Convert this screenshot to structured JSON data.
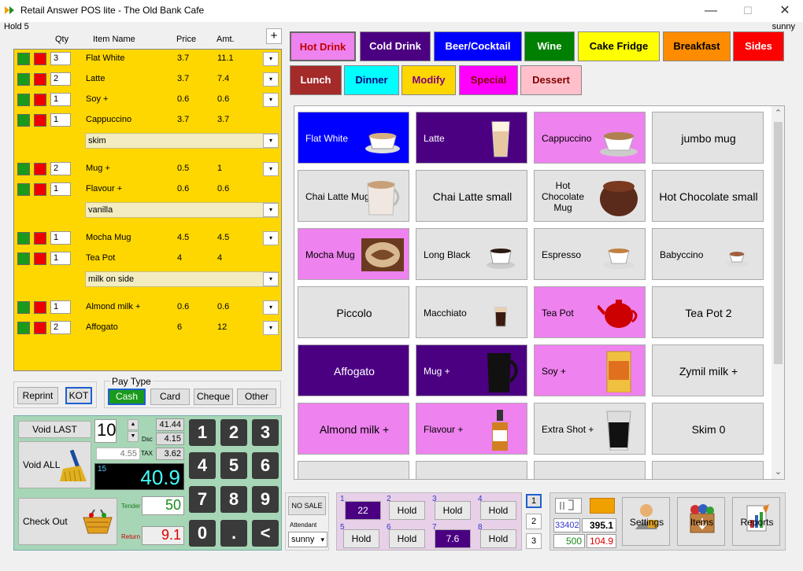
{
  "window": {
    "title": "Retail Answer POS lite - The Old Bank Cafe",
    "minimize": "—",
    "maximize": "☐",
    "close": "✕"
  },
  "hold_label": "Hold 5",
  "user": "sunny",
  "order_headers": {
    "add": "+",
    "qty": "Qty",
    "name": "Item Name",
    "price": "Price",
    "amt": "Amt."
  },
  "order_rows": [
    {
      "qty": "3",
      "name": "Flat White",
      "price": "3.7",
      "amt": "11.1"
    },
    {
      "qty": "2",
      "name": "Latte",
      "price": "3.7",
      "amt": "7.4"
    },
    {
      "qty": "1",
      "name": "Soy +",
      "price": "0.6",
      "amt": "0.6"
    },
    {
      "qty": "1",
      "name": "Cappuccino",
      "price": "3.7",
      "amt": "3.7"
    },
    {
      "qty": "2",
      "name": "Mug +",
      "price": "0.5",
      "amt": "1"
    },
    {
      "qty": "1",
      "name": "Flavour +",
      "price": "0.6",
      "amt": "0.6"
    },
    {
      "qty": "1",
      "name": "Mocha Mug",
      "price": "4.5",
      "amt": "4.5"
    },
    {
      "qty": "1",
      "name": "Tea Pot",
      "price": "4",
      "amt": "4"
    },
    {
      "qty": "1",
      "name": "Almond milk +",
      "price": "0.6",
      "amt": "0.6"
    },
    {
      "qty": "2",
      "name": "Affogato",
      "price": "6",
      "amt": "12"
    }
  ],
  "modifiers": [
    "skim",
    "vanilla",
    "milk on side"
  ],
  "dropdown_arrow": "▾",
  "reprint": "Reprint",
  "kot": "KOT",
  "pay_type": {
    "label": "Pay Type",
    "cash": "Cash",
    "card": "Card",
    "cheque": "Cheque",
    "other": "Other"
  },
  "actions": {
    "void_last": "Void LAST",
    "void_all": "Void ALL",
    "check_out": "Check Out"
  },
  "qty_entry": "10",
  "spin_up": "▲",
  "spin_down": "▼",
  "totals": {
    "subtotal": "41.44",
    "dsc_label": "Dsc",
    "dsc": "4.15",
    "tax_label": "TAX",
    "tax": "3.62",
    "net": "4.55",
    "count": "15",
    "total": "40.9",
    "tender_label": "Tender",
    "tender": "50",
    "return_label": "Return",
    "return": "9.1"
  },
  "keypad": [
    "1",
    "2",
    "3",
    "4",
    "5",
    "6",
    "7",
    "8",
    "9",
    "0",
    ".",
    "<"
  ],
  "categories": [
    {
      "label": "Hot Drink",
      "bg": "#ee82ee",
      "fg": "#c00000"
    },
    {
      "label": "Cold Drink",
      "bg": "#4b0082",
      "fg": "#ffffff"
    },
    {
      "label": "Beer/Cocktail",
      "bg": "#0000ff",
      "fg": "#ffffff"
    },
    {
      "label": "Wine",
      "bg": "#008000",
      "fg": "#ffffff"
    },
    {
      "label": "Cake Fridge",
      "bg": "#ffff00",
      "fg": "#000000"
    },
    {
      "label": "Breakfast",
      "bg": "#ff8c00",
      "fg": "#000000"
    },
    {
      "label": "Sides",
      "bg": "#ff0000",
      "fg": "#ffffff"
    },
    {
      "label": "Lunch",
      "bg": "#a52a2a",
      "fg": "#ffffff"
    },
    {
      "label": "Dinner",
      "bg": "#00ffff",
      "fg": "#000080"
    },
    {
      "label": "Modify",
      "bg": "#ffd700",
      "fg": "#800080"
    },
    {
      "label": "Special",
      "bg": "#ff00ff",
      "fg": "#800000"
    },
    {
      "label": "Dessert",
      "bg": "#ffc0cb",
      "fg": "#800000"
    }
  ],
  "menu_items": [
    {
      "label": "Flat White",
      "bg": "#0000ff",
      "fg": "#ffffff",
      "icon": "flat-white-cup-icon"
    },
    {
      "label": "Latte",
      "bg": "#4b0082",
      "fg": "#ffffff",
      "icon": "latte-glass-icon"
    },
    {
      "label": "Cappuccino",
      "bg": "#ee82ee",
      "fg": "#000000",
      "icon": "cappuccino-cup-icon"
    },
    {
      "label": "jumbo mug",
      "bg": "#e3e3e3",
      "fg": "#000000",
      "icon": ""
    },
    {
      "label": "Chai Latte Mug",
      "bg": "#e3e3e3",
      "fg": "#000000",
      "icon": "chai-latte-mug-icon"
    },
    {
      "label": "Chai Latte small",
      "bg": "#e3e3e3",
      "fg": "#000000",
      "icon": ""
    },
    {
      "label": "Hot Chocolate Mug",
      "bg": "#e3e3e3",
      "fg": "#000000",
      "icon": "hot-chocolate-mug-icon"
    },
    {
      "label": "Hot Chocolate small",
      "bg": "#e3e3e3",
      "fg": "#000000",
      "icon": ""
    },
    {
      "label": "Mocha Mug",
      "bg": "#ee82ee",
      "fg": "#000000",
      "icon": "mocha-mug-icon"
    },
    {
      "label": "Long Black",
      "bg": "#e3e3e3",
      "fg": "#000000",
      "icon": "long-black-cup-icon"
    },
    {
      "label": "Espresso",
      "bg": "#e3e3e3",
      "fg": "#000000",
      "icon": "espresso-cup-icon"
    },
    {
      "label": "Babyccino",
      "bg": "#e3e3e3",
      "fg": "#000000",
      "icon": "babyccino-cup-icon"
    },
    {
      "label": "Piccolo",
      "bg": "#e3e3e3",
      "fg": "#000000",
      "icon": ""
    },
    {
      "label": "Macchiato",
      "bg": "#e3e3e3",
      "fg": "#000000",
      "icon": "macchiato-glass-icon"
    },
    {
      "label": "Tea Pot",
      "bg": "#ee82ee",
      "fg": "#000000",
      "icon": "tea-pot-icon"
    },
    {
      "label": "Tea Pot 2",
      "bg": "#e3e3e3",
      "fg": "#000000",
      "icon": ""
    },
    {
      "label": "Affogato",
      "bg": "#4b0082",
      "fg": "#ffffff",
      "icon": ""
    },
    {
      "label": "Mug +",
      "bg": "#4b0082",
      "fg": "#ffffff",
      "icon": "black-mug-icon"
    },
    {
      "label": "Soy +",
      "bg": "#ee82ee",
      "fg": "#000000",
      "icon": "soy-milk-carton-icon"
    },
    {
      "label": "Zymil milk +",
      "bg": "#e3e3e3",
      "fg": "#000000",
      "icon": ""
    },
    {
      "label": "Almond milk +",
      "bg": "#ee82ee",
      "fg": "#000000",
      "icon": ""
    },
    {
      "label": "Flavour +",
      "bg": "#ee82ee",
      "fg": "#000000",
      "icon": "syrup-bottle-icon"
    },
    {
      "label": "Extra Shot +",
      "bg": "#e3e3e3",
      "fg": "#000000",
      "icon": "shot-glass-icon"
    },
    {
      "label": "Skim 0",
      "bg": "#e3e3e3",
      "fg": "#000000",
      "icon": ""
    }
  ],
  "scroll": {
    "up": "⌃",
    "down": "⌄"
  },
  "no_sale": "NO SALE",
  "attendant": {
    "label": "Attendant",
    "value": "sunny"
  },
  "holds": [
    {
      "num": "1",
      "label": "22",
      "active": true
    },
    {
      "num": "2",
      "label": "Hold",
      "active": false
    },
    {
      "num": "3",
      "label": "Hold",
      "active": false
    },
    {
      "num": "4",
      "label": "Hold",
      "active": false
    },
    {
      "num": "5",
      "label": "Hold",
      "active": false
    },
    {
      "num": "6",
      "label": "Hold",
      "active": false
    },
    {
      "num": "7",
      "label": "7.6",
      "active": true
    },
    {
      "num": "8",
      "label": "Hold",
      "active": false
    }
  ],
  "hold_pages": [
    "1",
    "2",
    "3"
  ],
  "register": {
    "sales_count": "33402",
    "sales_total": "395.1",
    "cash_in": "500",
    "cash_out": "104.9"
  },
  "tools": {
    "settings": "Settings",
    "items": "Items",
    "reports": "Reports"
  }
}
